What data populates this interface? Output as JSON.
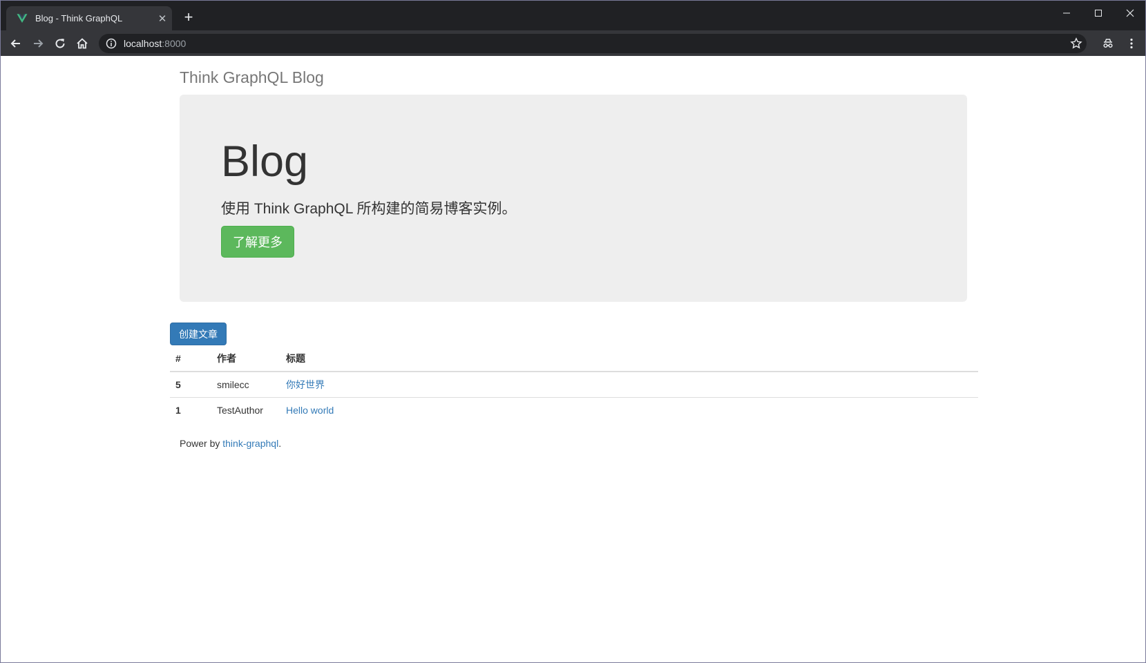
{
  "browser": {
    "tab_title": "Blog - Think GraphQL",
    "url_host": "localhost",
    "url_port": ":8000",
    "favicon_color": "#41b883"
  },
  "page": {
    "site_title": "Think GraphQL Blog",
    "jumbotron": {
      "heading": "Blog",
      "lead": "使用 Think GraphQL 所构建的简易博客实例。",
      "learn_more": "了解更多"
    },
    "create_button": "创建文章",
    "table": {
      "headers": {
        "id": "#",
        "author": "作者",
        "title": "标题"
      },
      "rows": [
        {
          "id": "5",
          "author": "smilecc",
          "title": "你好世界"
        },
        {
          "id": "1",
          "author": "TestAuthor",
          "title": "Hello world"
        }
      ]
    },
    "footer": {
      "prefix": "Power by ",
      "link": "think-graphql",
      "suffix": "."
    }
  },
  "colors": {
    "success": "#5cb85c",
    "primary": "#337ab7",
    "jumbotron_bg": "#eeeeee"
  }
}
